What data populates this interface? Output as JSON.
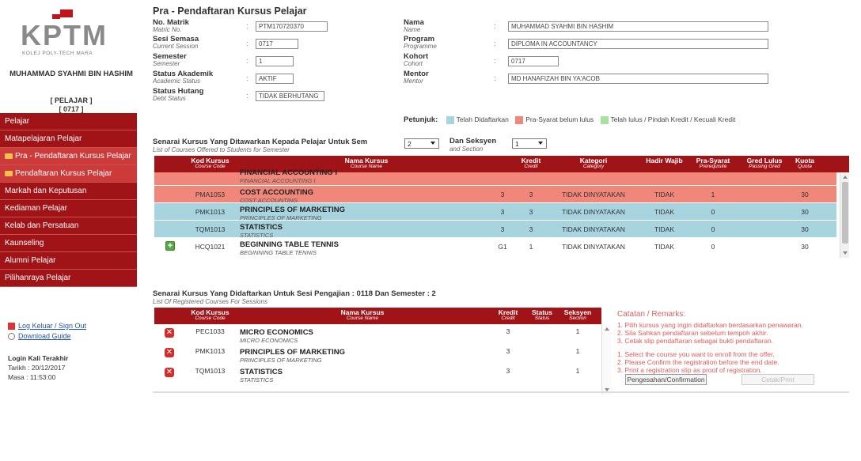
{
  "app": {
    "logo_text": "KPTM",
    "logo_sub": "KOLEJ POLY-TECH MARA",
    "student_name": "MUHAMMAD SYAHMI BIN HASHIM",
    "student_role": "[ PELAJAR ]",
    "student_id": "[ 0717 ]"
  },
  "sidebar": {
    "items": [
      {
        "label": "Pelajar"
      },
      {
        "label": "Matapelajaran Pelajar"
      },
      {
        "label": "Pra - Pendaftaran Kursus Pelajar"
      },
      {
        "label": "Pendaftaran Kursus Pelajar"
      },
      {
        "label": "Markah dan Keputusan"
      },
      {
        "label": "Kediaman Pelajar"
      },
      {
        "label": "Kelab dan Persatuan"
      },
      {
        "label": "Kaunseling"
      },
      {
        "label": "Alumni Pelajar"
      },
      {
        "label": "Pilihanraya Pelajar"
      }
    ],
    "logout": "Log Keluar / Sign Out",
    "guide": "Download Guide",
    "last_login_title": "Login Kali Terakhir",
    "date_label": "Tarikh",
    "date_value": ": 20/12/2017",
    "time_label": "Masa",
    "time_value": ": 11:53:00"
  },
  "main": {
    "title": "Pra - Pendaftaran Kursus Pelajar",
    "fields": {
      "matrik_label": "No. Matrik",
      "matrik_en": "Matric No.",
      "matrik_value": "PTM170720370",
      "sesi_label": "Sesi Semasa",
      "sesi_en": "Current Session",
      "sesi_value": "0717",
      "semester_label": "Semester",
      "semester_en": "Semester",
      "semester_value": "1",
      "status_label": "Status Akademik",
      "status_en": "Academic Status",
      "status_value": "AKTIF",
      "hutang_label": "Status Hutang",
      "hutang_en": "Debt Status",
      "hutang_value": "TIDAK BERHUTANG",
      "nama_label": "Nama",
      "nama_en": "Name",
      "nama_value": "MUHAMMAD SYAHMI BIN HASHIM",
      "program_label": "Program",
      "program_en": "Programme",
      "program_value": "DIPLOMA IN ACCOUNTANCY",
      "kohort_label": "Kohort",
      "kohort_en": "Cohort",
      "kohort_value": "0717",
      "mentor_label": "Mentor",
      "mentor_en": "Mentor",
      "mentor_value": "MD HANAFIZAH BIN YA'ACOB"
    },
    "legend": {
      "title": "Petunjuk:",
      "item1": "Telah Didaftarkan",
      "color1": "#a8d4e0",
      "item2": "Pra-Syarat belum lulus",
      "color2": "#f0877a",
      "item3": "Telah lulus / Pindah Kredit / Kecuali Kredit",
      "color3": "#a6e39a"
    },
    "offered": {
      "title": "Senarai Kursus Yang Ditawarkan Kepada Pelajar Untuk Sem",
      "title_en": "List of Courses Offered to Students for Semester",
      "sem_value": "2",
      "section_label": "Dan Seksyen",
      "section_en": "and Section",
      "section_value": "1",
      "headers": {
        "code": "Kod Kursus",
        "code_en": "Course Code",
        "name": "Nama Kursus",
        "name_en": "Course Name",
        "credit": "Kredit",
        "credit_en": "Credit",
        "cat": "Kategori",
        "cat_en": "Category",
        "hadir": "Hadir Wajib",
        "pre": "Pra-Syarat",
        "pre_en": "Prerequisite",
        "gred": "Gred Lulus",
        "gred_en": "Passing Gred",
        "kuota": "Kuota",
        "kuota_en": "Quota"
      },
      "rows": [
        {
          "code": "",
          "name": "FINANCIAL ACCOUNTING I",
          "name_en": "FINANCIAL ACCOUNTING I",
          "c1": "",
          "credit": "",
          "cat": "",
          "hadir": "",
          "pre": "",
          "kuota": ""
        },
        {
          "code": "PMA1053",
          "name": "COST ACCOUNTING",
          "name_en": "COST ACCOUNTING",
          "c1": "3",
          "credit": "3",
          "cat": "TIDAK DINYATAKAN",
          "hadir": "TIDAK",
          "pre": "1",
          "kuota": "30"
        },
        {
          "code": "PMK1013",
          "name": "PRINCIPLES OF MARKETING",
          "name_en": "PRINCIPLES OF MARKETING",
          "c1": "3",
          "credit": "3",
          "cat": "TIDAK DINYATAKAN",
          "hadir": "TIDAK",
          "pre": "0",
          "kuota": "30"
        },
        {
          "code": "TQM1013",
          "name": "STATISTICS",
          "name_en": "STATISTICS",
          "c1": "3",
          "credit": "3",
          "cat": "TIDAK DINYATAKAN",
          "hadir": "TIDAK",
          "pre": "0",
          "kuota": "30"
        },
        {
          "code": "HCQ1021",
          "name": "BEGINNING TABLE TENNIS",
          "name_en": "BEGINNING TABLE TENNIS",
          "c1": "G1",
          "credit": "1",
          "cat": "TIDAK DINYATAKAN",
          "hadir": "TIDAK",
          "pre": "0",
          "kuota": "30"
        }
      ]
    },
    "registered": {
      "title": "Senarai Kursus Yang Didaftarkan Untuk Sesi Pengajian : 0118 Dan Semester : 2",
      "title_en": "List Of Registered Courses For Sessions",
      "headers": {
        "code": "Kod Kursus",
        "code_en": "Course Code",
        "name": "Nama Kursus",
        "name_en": "Course Name",
        "credit": "Kredit",
        "credit_en": "Credit",
        "status": "Status",
        "status_en": "Status",
        "section": "Seksyen",
        "section_en": "Section"
      },
      "rows": [
        {
          "code": "PEC1033",
          "name": "MICRO ECONOMICS",
          "name_en": "MICRO ECONOMICS",
          "credit": "3",
          "section": "1"
        },
        {
          "code": "PMK1013",
          "name": "PRINCIPLES OF MARKETING",
          "name_en": "PRINCIPLES OF MARKETING",
          "credit": "3",
          "section": "1"
        },
        {
          "code": "TQM1013",
          "name": "STATISTICS",
          "name_en": "STATISTICS",
          "credit": "3",
          "section": "1"
        }
      ]
    },
    "remarks": {
      "title": "Catatan / Remarks:",
      "ms": [
        "1. Pilih kursus yang ingin didaftarkan berdasarkan penawaran.",
        "2. Sila Sahkan pendaftaran sebelum tempoh akhir.",
        "3. Cetak slip pendaftaran sebagai bukti pendaftaran."
      ],
      "en": [
        "1. Select the course you want to enroll from the offer.",
        "2. Please Confirm the registration before the end date.",
        "3. Print a registration slip as proof of registration."
      ],
      "confirm_btn": "Pengesahan/Confirmation",
      "print_btn": "Cetak/Print"
    }
  }
}
